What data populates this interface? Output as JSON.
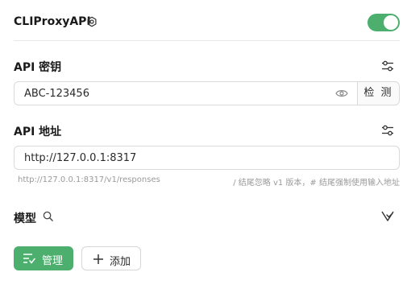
{
  "header": {
    "title": "CLIProxyAPI",
    "enabled": true,
    "accent": "#4caf6e"
  },
  "api_key": {
    "label": "API 密钥",
    "value": "ABC-123456",
    "detect_label": "检 测"
  },
  "api_address": {
    "label": "API 地址",
    "value": "http://127.0.0.1:8317",
    "hint_url": "http://127.0.0.1:8317/v1/responses",
    "hint_note": "/ 结尾忽略 v1 版本，# 结尾强制使用输入地址"
  },
  "models": {
    "label": "模型"
  },
  "actions": {
    "manage_label": "管理",
    "add_label": "添加"
  },
  "icons": [
    "gear-icon",
    "sliders-icon",
    "eye-icon",
    "search-icon",
    "filter-icon",
    "list-check-icon",
    "plus-icon"
  ]
}
